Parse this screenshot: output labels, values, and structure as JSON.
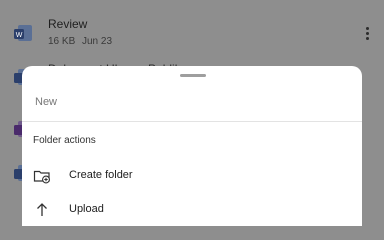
{
  "background_list": {
    "items": [
      {
        "title": "Review",
        "size": "16 KB",
        "date": "Jun 23"
      },
      {
        "title": "Dokument Ukuran Publik",
        "size": "",
        "date": ""
      }
    ]
  },
  "sheet": {
    "new_label": "New",
    "folder_actions_label": "Folder actions",
    "actions": [
      {
        "label": "Create folder",
        "icon": "create-folder-icon"
      },
      {
        "label": "Upload",
        "icon": "upload-arrow-icon"
      }
    ]
  },
  "colors": {
    "accent_word": "#2b579a",
    "onenote": "#7719aa"
  }
}
